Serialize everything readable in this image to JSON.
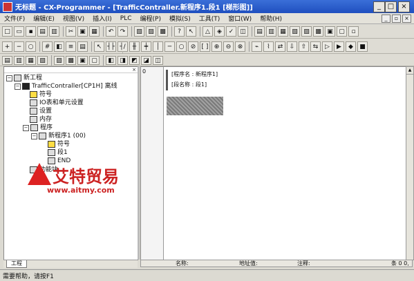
{
  "window": {
    "title": "无标题 - CX-Programmer - [TrafficContraller.新程序1.段1 [梯形图]]"
  },
  "menu": [
    "文件(F)",
    "编辑(E)",
    "视图(V)",
    "插入(I)",
    "PLC",
    "编程(P)",
    "模拟(S)",
    "工具(T)",
    "窗口(W)",
    "帮助(H)"
  ],
  "tree": {
    "root": "新工程",
    "plc": "TrafficContraller[CP1H] 离线",
    "items": [
      "符号",
      "IO表和单元设置",
      "设置",
      "内存",
      "程序"
    ],
    "program": "新程序1 (00)",
    "program_items": [
      "符号",
      "段1",
      "END"
    ],
    "function_blocks": "功能块"
  },
  "ladder": {
    "row_number": "0",
    "program_name": "[程序名 : 新程序1]",
    "section_name": "[段名称 : 段1]"
  },
  "left_tab": "工程",
  "bottom": {
    "name_col": "名称:",
    "addr_col": "地址值:",
    "comment_col": "注释:",
    "row_info": "条 0 0,"
  },
  "status_text": "需要帮助，请按F1",
  "watermark": {
    "brand": "艾特贸易",
    "url": "www.aitmy.com"
  }
}
